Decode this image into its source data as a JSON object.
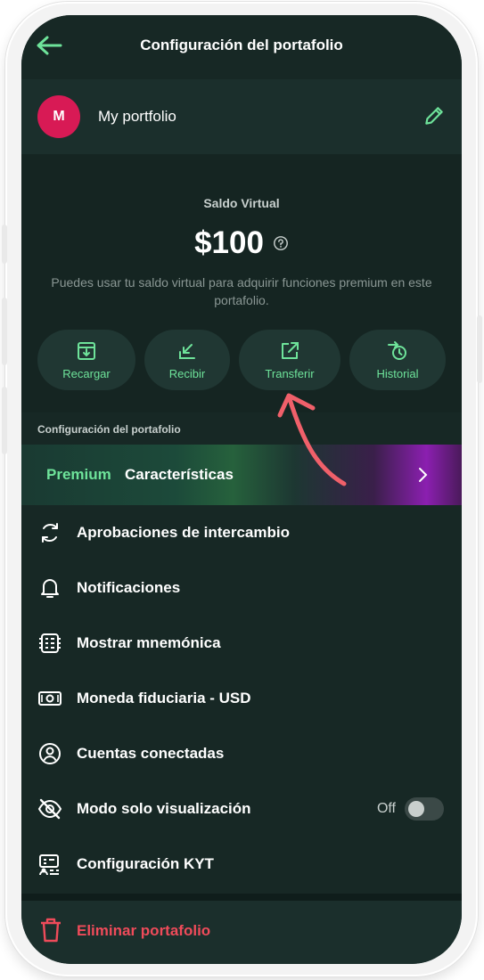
{
  "header": {
    "title": "Configuración del portafolio"
  },
  "portfolio": {
    "avatar_letter": "M",
    "name": "My portfolio"
  },
  "balance": {
    "label": "Saldo Virtual",
    "amount": "$100",
    "description": "Puedes usar tu saldo virtual para adquirir funciones premium en este portafolio."
  },
  "actions": [
    {
      "label": "Recargar",
      "icon": "recharge-icon"
    },
    {
      "label": "Recibir",
      "icon": "receive-icon"
    },
    {
      "label": "Transferir",
      "icon": "transfer-icon"
    },
    {
      "label": "Historial",
      "icon": "history-icon"
    }
  ],
  "section_title": "Configuración del portafolio",
  "premium": {
    "highlight": "Premium",
    "text": "Características"
  },
  "menu": [
    {
      "label": "Aprobaciones de intercambio",
      "icon": "refresh-icon"
    },
    {
      "label": "Notificaciones",
      "icon": "bell-icon"
    },
    {
      "label": "Mostrar mnemónica",
      "icon": "mnemonic-icon"
    },
    {
      "label": "Moneda fiduciaria - USD",
      "icon": "banknote-icon"
    },
    {
      "label": "Cuentas conectadas",
      "icon": "user-circle-icon"
    },
    {
      "label": "Modo solo visualización",
      "icon": "eye-off-icon",
      "toggle": "Off"
    },
    {
      "label": "Configuración KYT",
      "icon": "kyt-icon"
    }
  ],
  "delete": {
    "label": "Eliminar portafolio",
    "icon": "trash-icon"
  },
  "colors": {
    "background": "#172825",
    "accent": "#6ee39a",
    "danger": "#ef4b5a",
    "avatar": "#d81a55",
    "annotation_arrow": "#f0606a"
  }
}
